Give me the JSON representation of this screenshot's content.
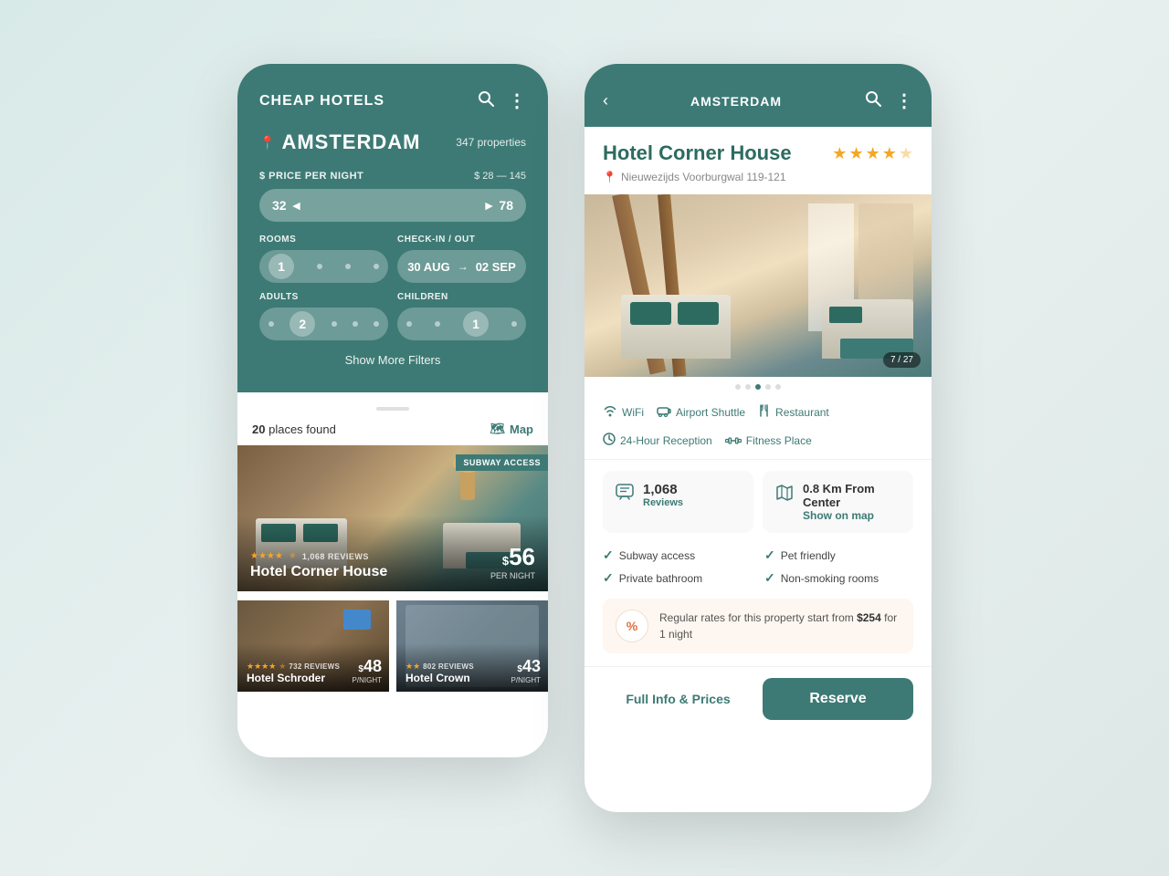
{
  "left_phone": {
    "header": {
      "title": "CHEAP HOTELS",
      "search_icon": "🔍",
      "more_icon": "⋮"
    },
    "location": {
      "pin_icon": "📍",
      "city": "AMSTERDAM",
      "properties": "347 properties"
    },
    "price_filter": {
      "label": "$ PRICE PER NIGHT",
      "range_text": "$ 28 — 145",
      "min_value": "32",
      "max_value": "78"
    },
    "rooms": {
      "label": "ROOMS",
      "value": "1"
    },
    "checkin": {
      "label": "CHECK-IN / OUT",
      "checkin": "30 AUG",
      "checkout": "02 SEP"
    },
    "adults": {
      "label": "ADULTS",
      "value": "2"
    },
    "children": {
      "label": "CHILDREN",
      "value": "1"
    },
    "show_filters": "Show More Filters",
    "results": {
      "count": "20",
      "text": "places found",
      "map_label": "Map"
    },
    "featured_hotel": {
      "badge": "SUBWAY ACCESS",
      "stars": "★★★★",
      "half_star": "★",
      "reviews": "1,068 REVIEWS",
      "name": "Hotel Corner House",
      "price_symbol": "$",
      "price": "56",
      "per_night": "PER NIGHT"
    },
    "small_hotel_1": {
      "stars": "★★★★",
      "half_star": "★",
      "reviews": "732 REVIEWS",
      "name": "Hotel Schroder",
      "price_symbol": "$",
      "price": "48",
      "per_night": "P/NIGHT"
    },
    "small_hotel_2": {
      "stars": "★★",
      "reviews": "802 REVIEWS",
      "name": "Hotel Crown",
      "price_symbol": "$",
      "price": "43",
      "per_night": "P/NIGHT"
    }
  },
  "right_phone": {
    "header": {
      "back_icon": "‹",
      "title": "AMSTERDAM",
      "search_icon": "🔍",
      "more_icon": "⋮"
    },
    "hotel": {
      "name": "Hotel Corner House",
      "stars": [
        "★",
        "★",
        "★",
        "★",
        "★"
      ],
      "star_count": 4.5,
      "address": "Nieuwezijds Voorburgwal 119-121",
      "photo_counter": "7 / 27"
    },
    "amenities": [
      {
        "icon": "📶",
        "label": "WiFi"
      },
      {
        "icon": "🚌",
        "label": "Airport Shuttle"
      },
      {
        "icon": "🍽",
        "label": "Restaurant"
      },
      {
        "icon": "🕐",
        "label": "24-Hour Reception"
      },
      {
        "icon": "🏋",
        "label": "Fitness Place"
      }
    ],
    "reviews_card": {
      "icon": "💬",
      "count": "1,068",
      "label": "Reviews"
    },
    "map_card": {
      "icon": "🗺",
      "distance": "0.8 Km From Center",
      "link": "Show on map"
    },
    "features": [
      {
        "label": "Subway access"
      },
      {
        "label": "Pet friendly"
      },
      {
        "label": "Private bathroom"
      },
      {
        "label": "Non-smoking rooms"
      }
    ],
    "promo": {
      "symbol": "%",
      "text_before": "Regular rates for this property start from ",
      "price": "$254",
      "text_after": " for 1 night"
    },
    "actions": {
      "full_info": "Full Info & Prices",
      "reserve": "Reserve"
    }
  },
  "colors": {
    "teal": "#3d7a75",
    "teal_dark": "#2d6b60",
    "star_gold": "#f5a623",
    "promo_bg": "#fef6f0",
    "promo_icon": "#e07040"
  }
}
